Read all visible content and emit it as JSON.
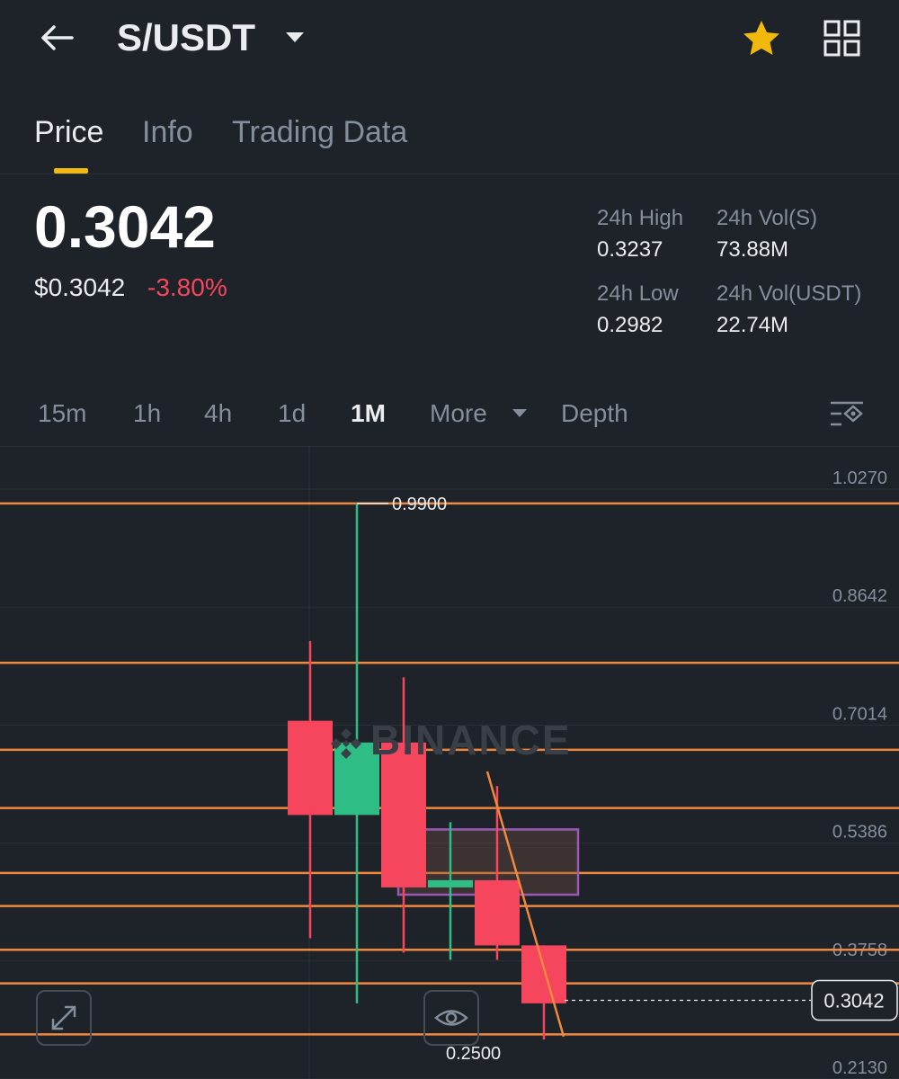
{
  "header": {
    "pair": "S/USDT",
    "icons": [
      "back-arrow-icon",
      "dropdown-caret-icon",
      "star-icon",
      "grid-icon"
    ],
    "star_color": "#f0b90b"
  },
  "tabs": [
    {
      "label": "Price",
      "active": true
    },
    {
      "label": "Info",
      "active": false
    },
    {
      "label": "Trading Data",
      "active": false
    }
  ],
  "price": {
    "last": "0.3042",
    "usd": "$0.3042",
    "change": "-3.80%",
    "change_color": "#f6465d"
  },
  "stats": {
    "high_label": "24h High",
    "high_value": "0.3237",
    "low_label": "24h Low",
    "low_value": "0.2982",
    "vol_s_label": "24h Vol(S)",
    "vol_s_value": "73.88M",
    "vol_usdt_label": "24h Vol(USDT)",
    "vol_usdt_value": "22.74M"
  },
  "intervals": [
    {
      "label": "15m",
      "active": false
    },
    {
      "label": "1h",
      "active": false
    },
    {
      "label": "4h",
      "active": false
    },
    {
      "label": "1d",
      "active": false
    },
    {
      "label": "1M",
      "active": true
    },
    {
      "label": "More",
      "active": false
    },
    {
      "label": "Depth",
      "active": false
    }
  ],
  "chart": {
    "watermark": "BINANCE",
    "max_label": "0.9900",
    "min_label": "0.2500",
    "current_price_label": "0.3042",
    "up_color": "#2ebd85",
    "down_color": "#f6465d",
    "line_color": "#f0883e",
    "box_color": "#9b59b6"
  },
  "chart_data": {
    "type": "candlestick",
    "y_axis_ticks": [
      "1.0270",
      "0.8642",
      "0.7014",
      "0.5386",
      "0.3758",
      "0.2130"
    ],
    "ylim": [
      0.213,
      1.027
    ],
    "candles": [
      {
        "open": 0.69,
        "high": 0.8,
        "low": 0.39,
        "close": 0.56
      },
      {
        "open": 0.56,
        "high": 0.99,
        "low": 0.3,
        "close": 0.66
      },
      {
        "open": 0.66,
        "high": 0.75,
        "low": 0.37,
        "close": 0.46
      },
      {
        "open": 0.46,
        "high": 0.55,
        "low": 0.36,
        "close": 0.47
      },
      {
        "open": 0.47,
        "high": 0.6,
        "low": 0.36,
        "close": 0.38
      },
      {
        "open": 0.38,
        "high": 0.37,
        "low": 0.25,
        "close": 0.3
      }
    ],
    "horizontal_lines": [
      0.99,
      0.77,
      0.65,
      0.5696,
      0.48,
      0.4344,
      0.374,
      0.3276,
      0.2572
    ],
    "rectangle": {
      "y_top": 0.54,
      "y_bottom": 0.45
    },
    "trend_line": {
      "y_start": 0.62,
      "y_end": 0.2541
    },
    "current_price": 0.3042
  }
}
